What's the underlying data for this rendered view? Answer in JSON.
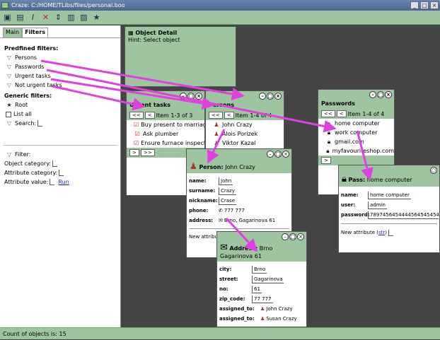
{
  "window": {
    "title": "Craze: C:/HOME/TLibs/files/personal.boo"
  },
  "toolbar": {
    "icons": [
      "save-icon",
      "table-icon",
      "italic-icon",
      "delete-icon",
      "move-icon",
      "print-icon",
      "image-icon",
      "star-icon"
    ]
  },
  "left": {
    "tabs": [
      "Main",
      "Filters"
    ],
    "predefined_title": "Predfined filters:",
    "predefined": [
      "Persons",
      "Passwords",
      "Urgent tasks",
      "Not urgent tasks"
    ],
    "generic_title": "Generic filters:",
    "generic": {
      "root": "Root",
      "list_all": "List all",
      "search": "Search:"
    },
    "filter_title": "Filter:",
    "object_category": "Object category:",
    "attribute_category": "Attribute category:",
    "attribute_value": "Attribute value:",
    "run": "Run"
  },
  "status": "Count of objects is: 15",
  "object_detail": {
    "title": "Object Detail",
    "hint": "Hint: Select object"
  },
  "urgent": {
    "title": "Urgent tasks",
    "count": "Item 1-3 of 3",
    "items": [
      "Buy present to marriage",
      "Ask plumber",
      "Ensure furnace inspection"
    ]
  },
  "persons": {
    "title": "Persons",
    "count": "Item 1-4 of 4",
    "items": [
      "John Crazy",
      "Alois Porizek",
      "Viktor Kazal"
    ]
  },
  "passwords": {
    "title": "Passwords",
    "count": "Item 1-4 of 4",
    "items": [
      "home computer",
      "work computer",
      "gmail.com",
      "myfavouriteshop.com"
    ]
  },
  "person": {
    "type": "Person:",
    "name": "John Crazy",
    "fields": [
      {
        "k": "name:",
        "v": "John"
      },
      {
        "k": "surname:",
        "v": "Crazy"
      },
      {
        "k": "nickname:",
        "v": "Crase"
      },
      {
        "k": "phone:",
        "v": "777 777"
      },
      {
        "k": "address:",
        "v": "Brno, Gagarinova 61"
      }
    ],
    "new_attr": "New attribute"
  },
  "pass": {
    "type": "Pass:",
    "name": "home computer",
    "fields": [
      {
        "k": "name:",
        "v": "home computer"
      },
      {
        "k": "user:",
        "v": "admin"
      },
      {
        "k": "password:",
        "v": "78974564544445645454545"
      }
    ],
    "new_attr": "New attribute (",
    "new_attr_link": "str",
    "new_attr_end": ")"
  },
  "address": {
    "type": "Address:",
    "name": "Brno",
    "sub": "Gagarinova 61",
    "fields": [
      {
        "k": "city:",
        "v": "Brno"
      },
      {
        "k": "street:",
        "v": "Gagarinova"
      },
      {
        "k": "no:",
        "v": "61"
      },
      {
        "k": "zip_code:",
        "v": "77 777"
      },
      {
        "k": "assigned_to:",
        "v": "John Crazy"
      },
      {
        "k": "assigned_to:",
        "v": "Susan Crazy"
      }
    ]
  },
  "colors": {
    "accent": "#9fc4a0",
    "arrow": "#e040e0",
    "background": "#444444"
  }
}
